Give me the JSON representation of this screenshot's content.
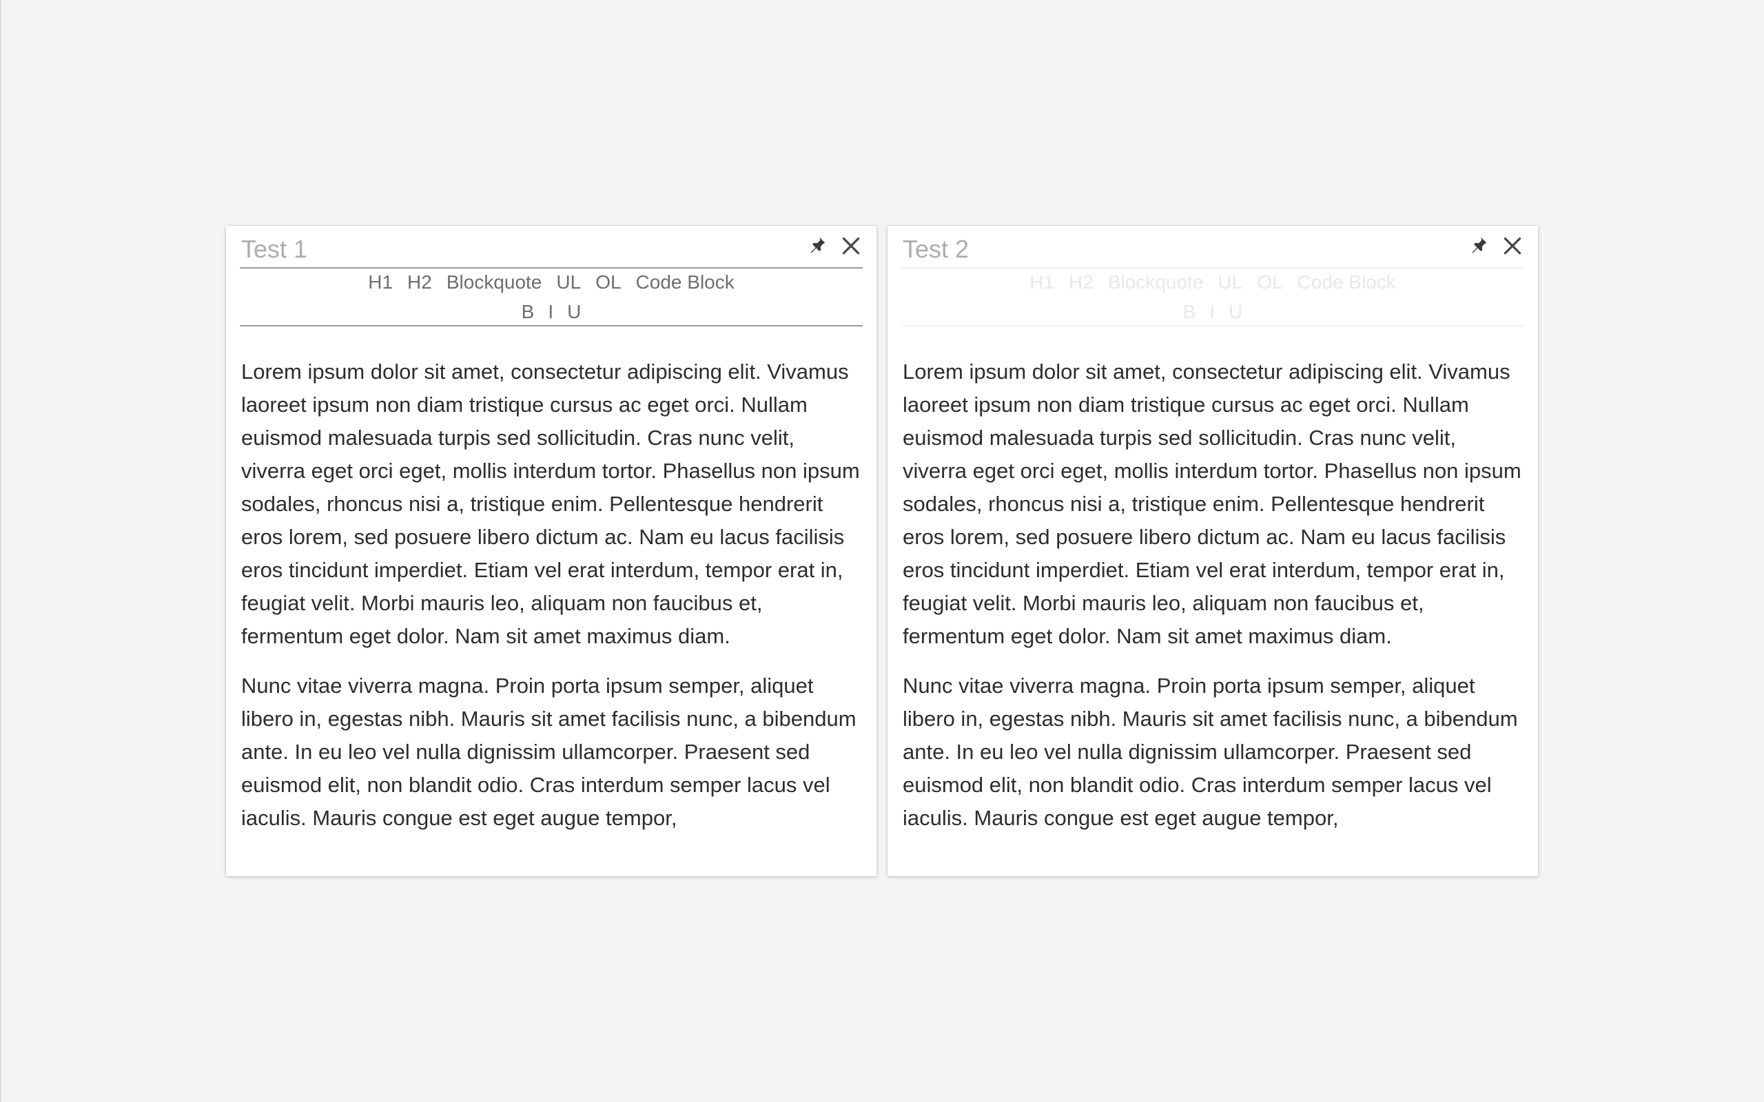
{
  "notes": [
    {
      "title": "Test 1",
      "state": "active",
      "toolbar": {
        "row1": [
          "H1",
          "H2",
          "Blockquote",
          "UL",
          "OL",
          "Code Block"
        ],
        "row2": [
          "B",
          "I",
          "U"
        ]
      },
      "paragraphs": [
        "Lorem ipsum dolor sit amet, consectetur adipiscing elit. Vivamus laoreet ipsum non diam tristique cursus ac eget orci. Nullam euismod malesuada turpis sed sollicitudin. Cras nunc velit, viverra eget orci eget, mollis interdum tortor. Phasellus non ipsum sodales, rhoncus nisi a, tristique enim. Pellentesque hendrerit eros lorem, sed posuere libero dictum ac. Nam eu lacus facilisis eros tincidunt imperdiet. Etiam vel erat interdum, tempor erat in, feugiat velit. Morbi mauris leo, aliquam non faucibus et, fermentum eget dolor. Nam sit amet maximus diam.",
        "Nunc vitae viverra magna. Proin porta ipsum semper, aliquet libero in, egestas nibh. Mauris sit amet facilisis nunc, a bibendum ante. In eu leo vel nulla dignissim ullamcorper. Praesent sed euismod elit, non blandit odio. Cras interdum semper lacus vel iaculis. Mauris congue est eget augue tempor,"
      ]
    },
    {
      "title": "Test 2",
      "state": "inactive",
      "toolbar": {
        "row1": [
          "H1",
          "H2",
          "Blockquote",
          "UL",
          "OL",
          "Code Block"
        ],
        "row2": [
          "B",
          "I",
          "U"
        ]
      },
      "paragraphs": [
        "Lorem ipsum dolor sit amet, consectetur adipiscing elit. Vivamus laoreet ipsum non diam tristique cursus ac eget orci. Nullam euismod malesuada turpis sed sollicitudin. Cras nunc velit, viverra eget orci eget, mollis interdum tortor. Phasellus non ipsum sodales, rhoncus nisi a, tristique enim. Pellentesque hendrerit eros lorem, sed posuere libero dictum ac. Nam eu lacus facilisis eros tincidunt imperdiet. Etiam vel erat interdum, tempor erat in, feugiat velit. Morbi mauris leo, aliquam non faucibus et, fermentum eget dolor. Nam sit amet maximus diam.",
        "Nunc vitae viverra magna. Proin porta ipsum semper, aliquet libero in, egestas nibh. Mauris sit amet facilisis nunc, a bibendum ante. In eu leo vel nulla dignissim ullamcorper. Praesent sed euismod elit, non blandit odio. Cras interdum semper lacus vel iaculis. Mauris congue est eget augue tempor,"
      ]
    }
  ],
  "icons": {
    "pin": "pin-icon",
    "close": "close-icon"
  },
  "colors": {
    "background": "#f4f4f4",
    "card": "#ffffff",
    "title_placeholder": "#adadad",
    "toolbar_active": "#6e6e6e",
    "toolbar_inactive": "#e8e8e8",
    "body_text": "#2d2d2d"
  }
}
